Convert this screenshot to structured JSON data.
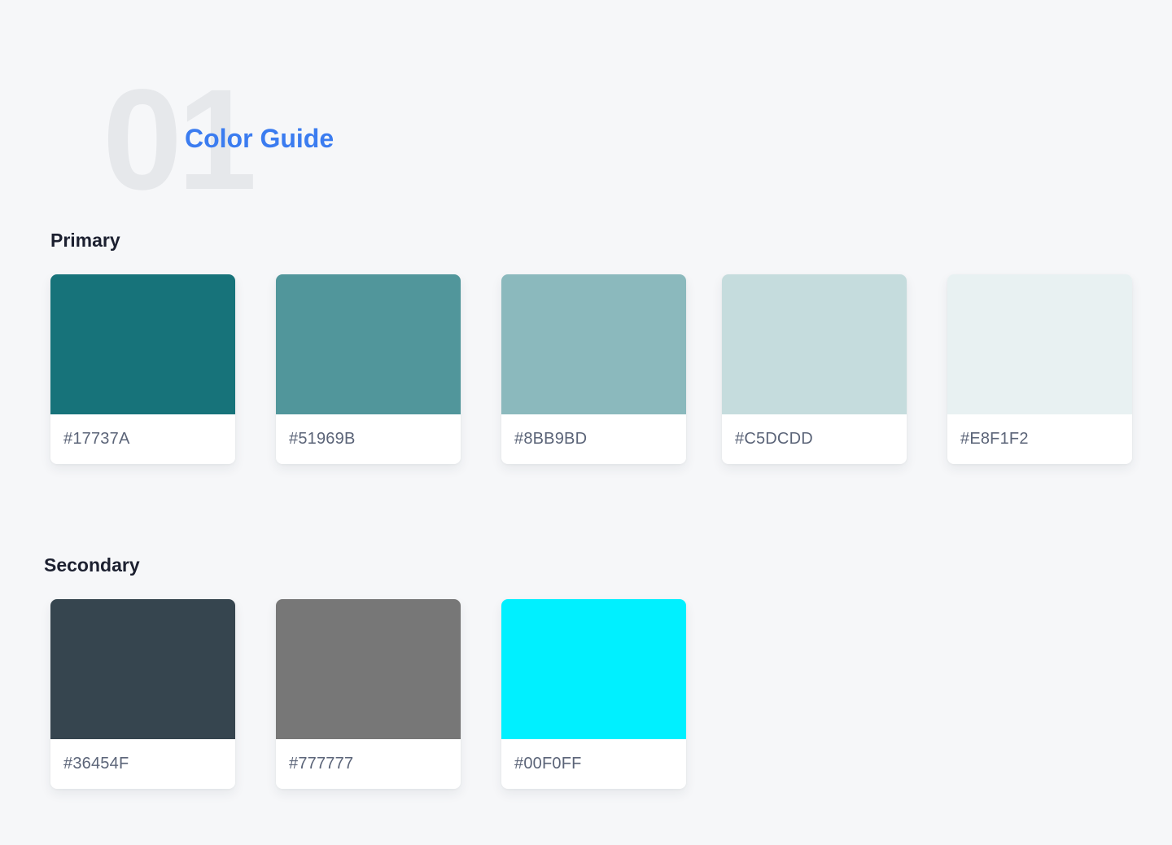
{
  "header": {
    "number": "01",
    "title": "Color Guide"
  },
  "primary": {
    "heading": "Primary",
    "swatches": [
      {
        "label": "#17737A",
        "color": "#17737A"
      },
      {
        "label": "#51969B",
        "color": "#51969B"
      },
      {
        "label": "#8BB9BD",
        "color": "#8BB9BD"
      },
      {
        "label": "#C5DCDD",
        "color": "#C5DCDD"
      },
      {
        "label": "#E8F1F2",
        "color": "#E8F1F2"
      }
    ]
  },
  "secondary": {
    "heading": "Secondary",
    "swatches": [
      {
        "label": "#36454F",
        "color": "#36454F"
      },
      {
        "label": "#777777",
        "color": "#777777"
      },
      {
        "label": "#00F0FF",
        "color": "#00F0FF"
      }
    ]
  },
  "theme": {
    "background": "#F6F7F9",
    "title_color": "#3B7CF0",
    "number_color": "#E6E8EB",
    "heading_color": "#1C2030",
    "label_color": "#5B6478"
  }
}
